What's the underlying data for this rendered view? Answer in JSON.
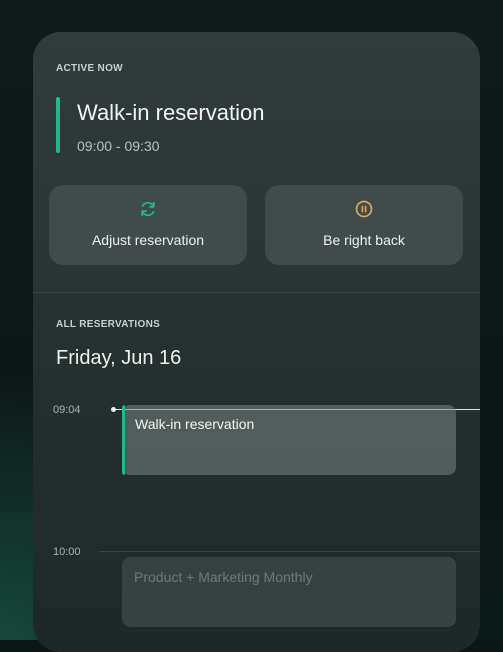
{
  "active_now": {
    "label": "ACTIVE NOW",
    "title": "Walk-in reservation",
    "time": "09:00 - 09:30",
    "accent_color": "#1fb98c",
    "actions": [
      {
        "label": "Adjust reservation",
        "icon": "refresh-icon",
        "icon_color": "#1fb98c"
      },
      {
        "label": "Be right back",
        "icon": "pause-icon",
        "icon_color": "#e0a95a"
      }
    ]
  },
  "all_reservations": {
    "label": "ALL RESERVATIONS",
    "date": "Friday, Jun 16",
    "current_time": "09:04",
    "hours": [
      "10:00"
    ],
    "events": [
      {
        "title": "Walk-in reservation",
        "state": "current"
      },
      {
        "title": "Product + Marketing Monthly",
        "state": "upcoming"
      }
    ]
  }
}
